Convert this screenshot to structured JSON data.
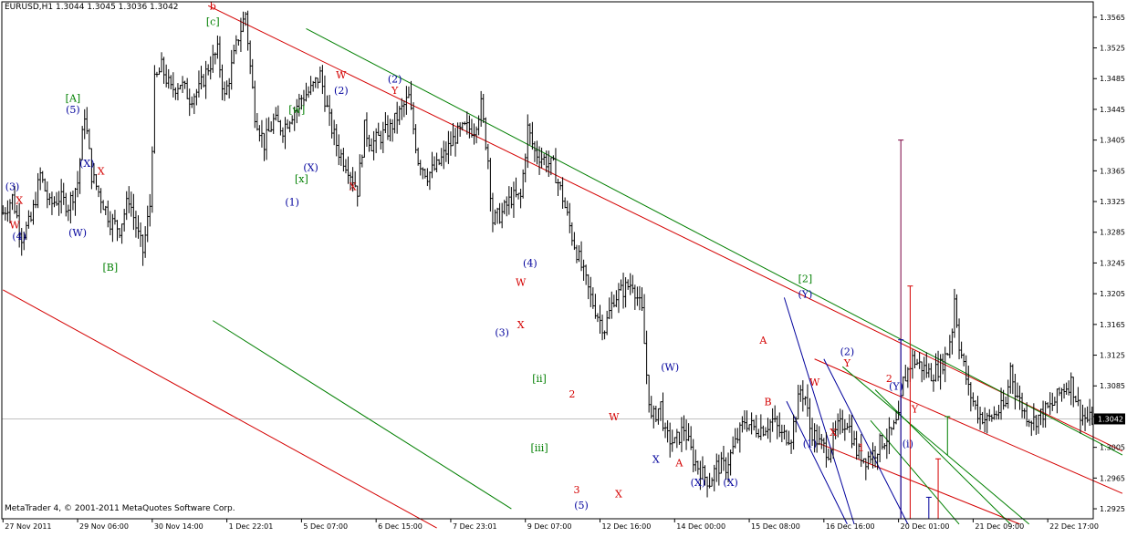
{
  "window": {
    "symbol_line": "EURUSD,H1  1.3044 1.3045 1.3036 1.3042",
    "copyright": "MetaTrader 4, © 2001-2011 MetaQuotes Software Corp."
  },
  "colors": {
    "background": "#ffffff",
    "bars": "#000000",
    "axis": "#000000",
    "current_price_bg": "#000000",
    "current_price_line": "#c0c0c0",
    "red": "#d40000",
    "green": "#007f00",
    "blue": "#00009c",
    "purple": "#7a0040"
  },
  "chart_data": {
    "type": "ohlc",
    "symbol": "EURUSD",
    "timeframe": "H1",
    "current_price": "1.3042",
    "ylim": [
      1.2912,
      1.3585
    ],
    "y_ticks": [
      "1.3565",
      "1.3525",
      "1.3485",
      "1.3445",
      "1.3405",
      "1.3365",
      "1.3325",
      "1.3285",
      "1.3245",
      "1.3205",
      "1.3165",
      "1.3125",
      "1.3085",
      "1.3045",
      "1.3005",
      "1.2965",
      "1.2925"
    ],
    "x_ticks": [
      "27 Nov 2011",
      "29 Nov 06:00",
      "30 Nov 14:00",
      "1 Dec 22:01",
      "5 Dec 07:00",
      "6 Dec 15:00",
      "7 Dec 23:01",
      "9 Dec 07:00",
      "12 Dec 16:00",
      "14 Dec 00:00",
      "15 Dec 08:00",
      "16 Dec 16:00",
      "20 Dec 01:00",
      "21 Dec 09:00",
      "22 Dec 17:00"
    ],
    "x_tick_bar_index": [
      0,
      32,
      64,
      96,
      128,
      160,
      192,
      224,
      256,
      288,
      320,
      352,
      384,
      416,
      448
    ],
    "bar_count": 468,
    "price_path": [
      [
        0,
        1.331
      ],
      [
        4,
        1.333
      ],
      [
        8,
        1.328
      ],
      [
        12,
        1.33
      ],
      [
        16,
        1.336
      ],
      [
        20,
        1.332
      ],
      [
        24,
        1.333
      ],
      [
        28,
        1.332
      ],
      [
        32,
        1.335
      ],
      [
        35,
        1.344
      ],
      [
        38,
        1.336
      ],
      [
        42,
        1.333
      ],
      [
        46,
        1.33
      ],
      [
        50,
        1.329
      ],
      [
        54,
        1.333
      ],
      [
        58,
        1.328
      ],
      [
        60,
        1.326
      ],
      [
        63,
        1.332
      ],
      [
        65,
        1.348
      ],
      [
        68,
        1.35
      ],
      [
        72,
        1.347
      ],
      [
        76,
        1.348
      ],
      [
        80,
        1.346
      ],
      [
        84,
        1.347
      ],
      [
        88,
        1.35
      ],
      [
        92,
        1.352
      ],
      [
        95,
        1.346
      ],
      [
        98,
        1.35
      ],
      [
        101,
        1.354
      ],
      [
        104,
        1.357
      ],
      [
        106,
        1.35
      ],
      [
        108,
        1.344
      ],
      [
        112,
        1.34
      ],
      [
        116,
        1.343
      ],
      [
        120,
        1.342
      ],
      [
        124,
        1.344
      ],
      [
        128,
        1.346
      ],
      [
        132,
        1.347
      ],
      [
        136,
        1.349
      ],
      [
        140,
        1.343
      ],
      [
        144,
        1.339
      ],
      [
        148,
        1.337
      ],
      [
        152,
        1.334
      ],
      [
        155,
        1.342
      ],
      [
        158,
        1.34
      ],
      [
        162,
        1.341
      ],
      [
        166,
        1.342
      ],
      [
        170,
        1.344
      ],
      [
        174,
        1.346
      ],
      [
        178,
        1.338
      ],
      [
        182,
        1.336
      ],
      [
        186,
        1.337
      ],
      [
        190,
        1.339
      ],
      [
        194,
        1.341
      ],
      [
        198,
        1.342
      ],
      [
        202,
        1.342
      ],
      [
        205,
        1.345
      ],
      [
        208,
        1.338
      ],
      [
        210,
        1.33
      ],
      [
        214,
        1.331
      ],
      [
        218,
        1.333
      ],
      [
        222,
        1.333
      ],
      [
        225,
        1.342
      ],
      [
        228,
        1.339
      ],
      [
        232,
        1.338
      ],
      [
        236,
        1.337
      ],
      [
        240,
        1.333
      ],
      [
        244,
        1.328
      ],
      [
        248,
        1.324
      ],
      [
        252,
        1.32
      ],
      [
        256,
        1.317
      ],
      [
        258,
        1.316
      ],
      [
        262,
        1.32
      ],
      [
        266,
        1.321
      ],
      [
        270,
        1.322
      ],
      [
        274,
        1.318
      ],
      [
        276,
        1.31
      ],
      [
        278,
        1.304
      ],
      [
        282,
        1.306
      ],
      [
        284,
        1.302
      ],
      [
        288,
        1.301
      ],
      [
        292,
        1.303
      ],
      [
        296,
        1.299
      ],
      [
        300,
        1.297
      ],
      [
        303,
        1.296
      ],
      [
        306,
        1.298
      ],
      [
        310,
        1.298
      ],
      [
        314,
        1.301
      ],
      [
        318,
        1.304
      ],
      [
        322,
        1.303
      ],
      [
        326,
        1.303
      ],
      [
        330,
        1.304
      ],
      [
        334,
        1.302
      ],
      [
        338,
        1.302
      ],
      [
        342,
        1.308
      ],
      [
        344,
        1.307
      ],
      [
        346,
        1.303
      ],
      [
        350,
        1.301
      ],
      [
        354,
        1.3
      ],
      [
        358,
        1.303
      ],
      [
        362,
        1.304
      ],
      [
        366,
        1.3
      ],
      [
        370,
        1.299
      ],
      [
        374,
        1.3
      ],
      [
        376,
        1.301
      ],
      [
        380,
        1.302
      ],
      [
        384,
        1.304
      ],
      [
        386,
        1.309
      ],
      [
        390,
        1.312
      ],
      [
        394,
        1.311
      ],
      [
        398,
        1.31
      ],
      [
        402,
        1.311
      ],
      [
        405,
        1.313
      ],
      [
        407,
        1.316
      ],
      [
        408,
        1.32
      ],
      [
        410,
        1.314
      ],
      [
        414,
        1.308
      ],
      [
        418,
        1.305
      ],
      [
        422,
        1.304
      ],
      [
        426,
        1.305
      ],
      [
        430,
        1.306
      ],
      [
        432,
        1.311
      ],
      [
        434,
        1.308
      ],
      [
        438,
        1.305
      ],
      [
        442,
        1.304
      ],
      [
        446,
        1.305
      ],
      [
        450,
        1.306
      ],
      [
        454,
        1.308
      ],
      [
        458,
        1.309
      ],
      [
        460,
        1.307
      ],
      [
        462,
        1.305
      ],
      [
        465,
        1.304
      ],
      [
        467,
        1.3042
      ]
    ],
    "trendlines": [
      {
        "color": "red",
        "points": [
          [
            88,
            1.358
          ],
          [
            480,
            1.3
          ]
        ]
      },
      {
        "color": "green",
        "points": [
          [
            130,
            1.355
          ],
          [
            480,
            1.2995
          ]
        ]
      },
      {
        "color": "red",
        "points": [
          [
            0,
            1.321
          ],
          [
            186,
            1.29
          ]
        ]
      },
      {
        "color": "green",
        "points": [
          [
            90,
            1.317
          ],
          [
            218,
            1.2925
          ]
        ]
      },
      {
        "color": "red",
        "points": [
          [
            348,
            1.312
          ],
          [
            480,
            1.2945
          ]
        ]
      },
      {
        "color": "red",
        "points": [
          [
            350,
            1.301
          ],
          [
            436,
            1.2905
          ]
        ]
      },
      {
        "color": "blue",
        "points": [
          [
            335,
            1.32
          ],
          [
            365,
            1.2905
          ]
        ]
      },
      {
        "color": "blue",
        "points": [
          [
            352,
            1.312
          ],
          [
            388,
            1.2905
          ]
        ]
      },
      {
        "color": "blue",
        "points": [
          [
            336,
            1.3065
          ],
          [
            362,
            1.2905
          ]
        ]
      },
      {
        "color": "green",
        "points": [
          [
            360,
            1.311
          ],
          [
            440,
            1.2905
          ]
        ]
      },
      {
        "color": "green",
        "points": [
          [
            374,
            1.308
          ],
          [
            432,
            1.2905
          ]
        ]
      },
      {
        "color": "green",
        "points": [
          [
            372,
            1.304
          ],
          [
            410,
            1.2905
          ]
        ]
      }
    ],
    "vertical_lines": [
      {
        "color": "purple",
        "bar": 385,
        "from": 1.2912,
        "to": 1.3405
      },
      {
        "color": "blue",
        "bar": 385,
        "from": 1.2912,
        "to": 1.3145
      },
      {
        "color": "red",
        "bar": 389,
        "from": 1.2912,
        "to": 1.3215
      },
      {
        "color": "blue",
        "bar": 397,
        "from": 1.2912,
        "to": 1.294
      },
      {
        "color": "red",
        "bar": 401,
        "from": 1.2912,
        "to": 1.299
      },
      {
        "color": "green",
        "bar": 405,
        "from": 1.2995,
        "to": 1.3045
      }
    ],
    "wave_labels": [
      {
        "text": "b",
        "bar": 90,
        "price": 1.3575,
        "color": "red"
      },
      {
        "text": "[c]",
        "bar": 90,
        "price": 1.3555,
        "color": "green"
      },
      {
        "text": "[A]",
        "bar": 30,
        "price": 1.3455,
        "color": "green"
      },
      {
        "text": "(5)",
        "bar": 30,
        "price": 1.344,
        "color": "blue"
      },
      {
        "text": "(3)",
        "bar": 4,
        "price": 1.334,
        "color": "blue"
      },
      {
        "text": "X",
        "bar": 7,
        "price": 1.3322,
        "color": "red"
      },
      {
        "text": "W",
        "bar": 5,
        "price": 1.329,
        "color": "red"
      },
      {
        "text": "(4)",
        "bar": 7,
        "price": 1.3275,
        "color": "blue"
      },
      {
        "text": "(X)",
        "bar": 36,
        "price": 1.337,
        "color": "blue"
      },
      {
        "text": "X",
        "bar": 42,
        "price": 1.336,
        "color": "red"
      },
      {
        "text": "(W)",
        "bar": 32,
        "price": 1.328,
        "color": "blue"
      },
      {
        "text": "[B]",
        "bar": 46,
        "price": 1.3235,
        "color": "green"
      },
      {
        "text": "(1)",
        "bar": 124,
        "price": 1.332,
        "color": "blue"
      },
      {
        "text": "[w]",
        "bar": 126,
        "price": 1.344,
        "color": "green"
      },
      {
        "text": "(X)",
        "bar": 132,
        "price": 1.3365,
        "color": "blue"
      },
      {
        "text": "[x]",
        "bar": 128,
        "price": 1.335,
        "color": "green"
      },
      {
        "text": "W",
        "bar": 145,
        "price": 1.3485,
        "color": "red"
      },
      {
        "text": "(2)",
        "bar": 145,
        "price": 1.3465,
        "color": "blue"
      },
      {
        "text": "X",
        "bar": 150,
        "price": 1.334,
        "color": "red"
      },
      {
        "text": "(2)",
        "bar": 168,
        "price": 1.348,
        "color": "blue"
      },
      {
        "text": "Y",
        "bar": 168,
        "price": 1.3465,
        "color": "red"
      },
      {
        "text": "(4)",
        "bar": 226,
        "price": 1.324,
        "color": "blue"
      },
      {
        "text": "W",
        "bar": 222,
        "price": 1.3215,
        "color": "red"
      },
      {
        "text": "(3)",
        "bar": 214,
        "price": 1.315,
        "color": "blue"
      },
      {
        "text": "X",
        "bar": 222,
        "price": 1.316,
        "color": "red"
      },
      {
        "text": "[ii]",
        "bar": 230,
        "price": 1.309,
        "color": "green"
      },
      {
        "text": "[iii]",
        "bar": 230,
        "price": 1.3,
        "color": "green"
      },
      {
        "text": "2",
        "bar": 244,
        "price": 1.307,
        "color": "red"
      },
      {
        "text": "3",
        "bar": 246,
        "price": 1.2945,
        "color": "red"
      },
      {
        "text": "(5)",
        "bar": 248,
        "price": 1.2925,
        "color": "blue"
      },
      {
        "text": "X",
        "bar": 264,
        "price": 1.294,
        "color": "red"
      },
      {
        "text": "W",
        "bar": 262,
        "price": 1.304,
        "color": "red"
      },
      {
        "text": "(W)",
        "bar": 286,
        "price": 1.3105,
        "color": "blue"
      },
      {
        "text": "X",
        "bar": 280,
        "price": 1.2985,
        "color": "blue"
      },
      {
        "text": "A",
        "bar": 290,
        "price": 1.298,
        "color": "red"
      },
      {
        "text": "(X)",
        "bar": 298,
        "price": 1.2955,
        "color": "blue"
      },
      {
        "text": "(X)",
        "bar": 312,
        "price": 1.2955,
        "color": "blue"
      },
      {
        "text": "A",
        "bar": 326,
        "price": 1.314,
        "color": "red"
      },
      {
        "text": "B",
        "bar": 328,
        "price": 1.306,
        "color": "red"
      },
      {
        "text": "[2]",
        "bar": 344,
        "price": 1.322,
        "color": "green"
      },
      {
        "text": "(Y)",
        "bar": 344,
        "price": 1.32,
        "color": "blue"
      },
      {
        "text": "W",
        "bar": 348,
        "price": 1.3085,
        "color": "red"
      },
      {
        "text": "(1)",
        "bar": 346,
        "price": 1.3005,
        "color": "blue"
      },
      {
        "text": "X",
        "bar": 356,
        "price": 1.302,
        "color": "red"
      },
      {
        "text": "(2)",
        "bar": 362,
        "price": 1.3125,
        "color": "blue"
      },
      {
        "text": "Y",
        "bar": 362,
        "price": 1.311,
        "color": "red"
      },
      {
        "text": "1",
        "bar": 368,
        "price": 1.3,
        "color": "red"
      },
      {
        "text": "2",
        "bar": 380,
        "price": 1.309,
        "color": "red"
      },
      {
        "text": "(Y)",
        "bar": 383,
        "price": 1.308,
        "color": "blue"
      },
      {
        "text": "(i)",
        "bar": 388,
        "price": 1.3005,
        "color": "blue"
      },
      {
        "text": "Y",
        "bar": 391,
        "price": 1.305,
        "color": "red"
      }
    ]
  }
}
